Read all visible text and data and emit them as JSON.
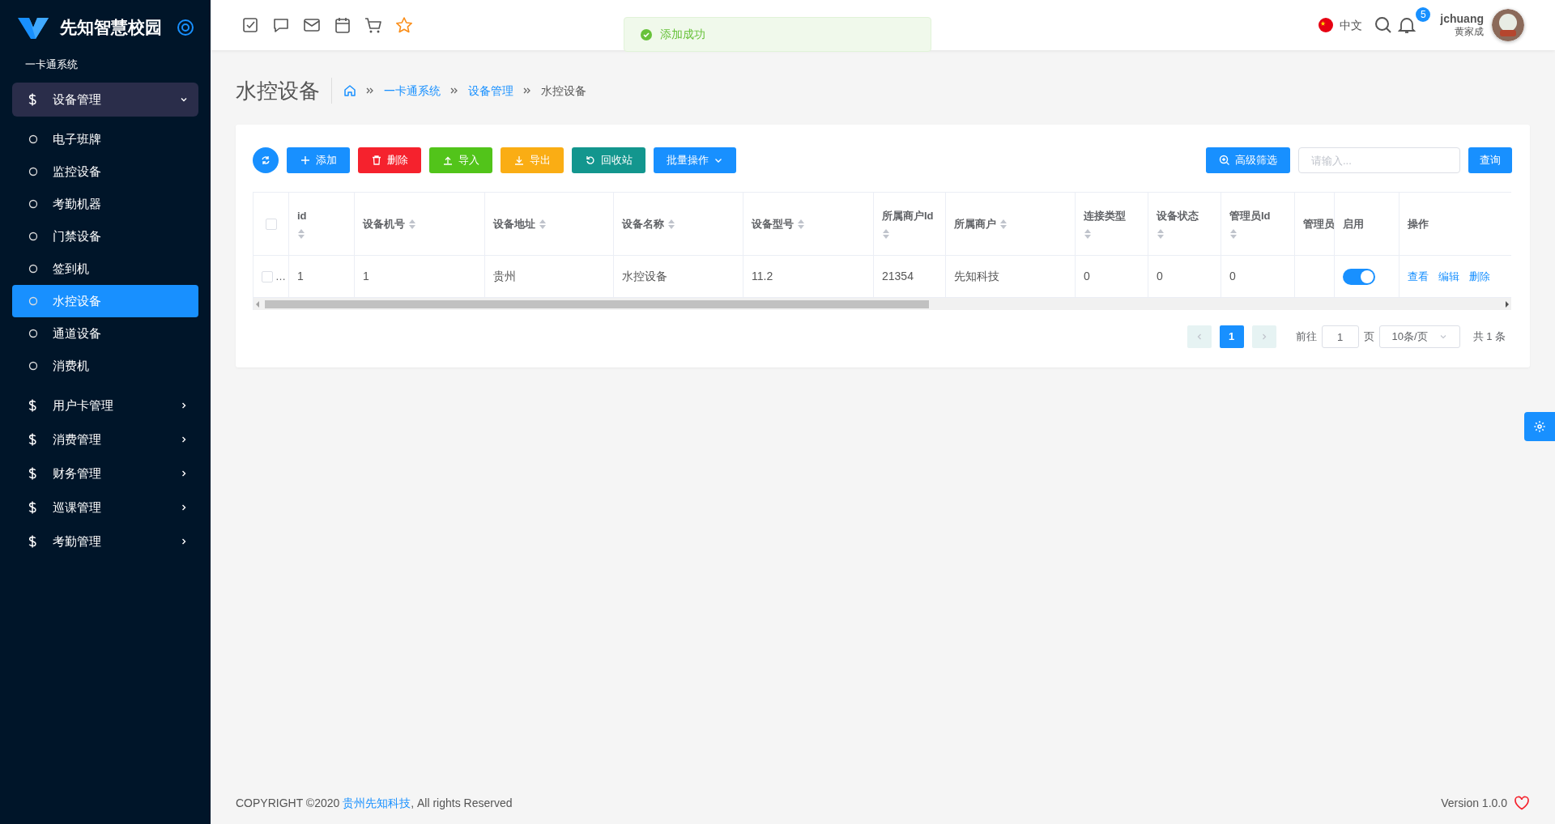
{
  "sidebar": {
    "logo_text": "先知智慧校园",
    "system_label": "一卡通系统",
    "menu": [
      {
        "label": "设备管理",
        "expanded": true,
        "children": [
          {
            "label": "电子班牌",
            "selected": false
          },
          {
            "label": "监控设备",
            "selected": false
          },
          {
            "label": "考勤机器",
            "selected": false
          },
          {
            "label": "门禁设备",
            "selected": false
          },
          {
            "label": "签到机",
            "selected": false
          },
          {
            "label": "水控设备",
            "selected": true
          },
          {
            "label": "通道设备",
            "selected": false
          },
          {
            "label": "消费机",
            "selected": false
          }
        ]
      },
      {
        "label": "用户卡管理",
        "expanded": false
      },
      {
        "label": "消费管理",
        "expanded": false
      },
      {
        "label": "财务管理",
        "expanded": false
      },
      {
        "label": "巡课管理",
        "expanded": false
      },
      {
        "label": "考勤管理",
        "expanded": false
      }
    ]
  },
  "header": {
    "language": "中文",
    "notification_count": "5",
    "username": "jchuang",
    "real_name": "黄家成"
  },
  "toast": {
    "message": "添加成功"
  },
  "page": {
    "title": "水控设备",
    "breadcrumb": [
      {
        "label": "一卡通系统",
        "link": true
      },
      {
        "label": "设备管理",
        "link": true
      },
      {
        "label": "水控设备",
        "link": false
      }
    ]
  },
  "toolbar": {
    "buttons": [
      {
        "kind": "refresh"
      },
      {
        "kind": "add",
        "label": "添加"
      },
      {
        "kind": "delete",
        "label": "删除"
      },
      {
        "kind": "import",
        "label": "导入"
      },
      {
        "kind": "export",
        "label": "导出"
      },
      {
        "kind": "recycle",
        "label": "回收站"
      },
      {
        "kind": "batch",
        "label": "批量操作"
      }
    ],
    "filter_button": "高级筛选",
    "search_placeholder": "请输入...",
    "query_button": "查询"
  },
  "table": {
    "select_all_checked": false,
    "columns": [
      {
        "label": "id",
        "sortable": true
      },
      {
        "label": "设备机号",
        "sortable": true
      },
      {
        "label": "设备地址",
        "sortable": true
      },
      {
        "label": "设备名称",
        "sortable": true
      },
      {
        "label": "设备型号",
        "sortable": true
      },
      {
        "label": "所属商户Id",
        "sortable": true
      },
      {
        "label": "所属商户",
        "sortable": true
      },
      {
        "label": "连接类型",
        "sortable": true
      },
      {
        "label": "设备状态",
        "sortable": true
      },
      {
        "label": "管理员Id",
        "sortable": true
      },
      {
        "label": "管理员",
        "sortable": false
      },
      {
        "label": "启用",
        "sortable": false
      },
      {
        "label": "操作",
        "sortable": false
      }
    ],
    "rows": [
      {
        "checked": false,
        "selection_text": "…",
        "cells": [
          "1",
          "1",
          "贵州",
          "水控设备",
          "11.2",
          "21354",
          "先知科技",
          "0",
          "0",
          "0",
          null
        ],
        "enabled": true,
        "actions": [
          "查看",
          "编辑",
          "删除"
        ]
      }
    ]
  },
  "pagination": {
    "prev_disabled": true,
    "next_disabled": true,
    "pages": [
      {
        "label": "1",
        "selected": true
      }
    ],
    "goto_label": "前往",
    "goto_value": "1",
    "page_unit": "页",
    "page_size": "10条/页",
    "total": "共 1 条"
  },
  "footer": {
    "copyright": "COPYRIGHT ©2020 ",
    "company": "贵州先知科技",
    "rights": ", All rights Reserved",
    "version": "Version 1.0.0"
  }
}
